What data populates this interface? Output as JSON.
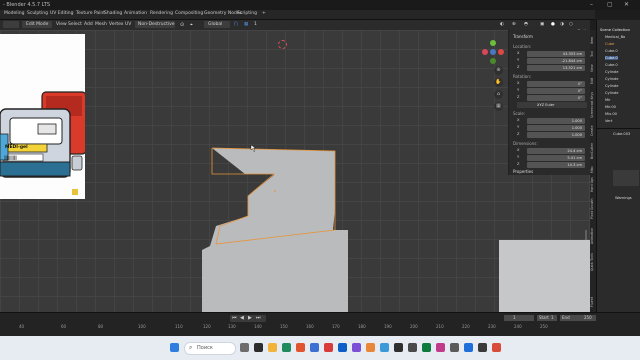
{
  "window": {
    "title": "- Blender 4.5.7 LTS"
  },
  "menus": [
    "Modeling",
    "Sculpting",
    "UV Editing",
    "Texture Paint",
    "Shading",
    "Animation",
    "Rendering",
    "Compositing",
    "Geometry Nodes",
    "Scripting"
  ],
  "toolbar": {
    "edit_mode": "Edit Mode",
    "view": "View",
    "select": "Select",
    "add": "Add",
    "mesh": "Mesh",
    "vertex": "Vertex",
    "edge": "Edge",
    "face": "Face",
    "uv": "UV",
    "non_destructive": "Non-Destructive",
    "transform_orientation": "Global",
    "snap_value": "1",
    "proportional": "1.00 m",
    "options": "Options"
  },
  "reference_image": {
    "label_text": "MEDI-gel",
    "barcode_text": "|||||||||||||||"
  },
  "npanel": {
    "section_transform": "Transform",
    "location_label": "Location:",
    "location": {
      "x": "43.353 cm",
      "y": "-21.844 cm",
      "z": "13.521 cm"
    },
    "rotation_label": "Rotation:",
    "rotation": {
      "x": "0°",
      "y": "0°",
      "z": "0°"
    },
    "rotation_mode": "XYZ Euler",
    "scale_label": "Scale:",
    "scale": {
      "x": "1.000",
      "y": "1.000",
      "z": "1.000"
    },
    "dimensions_label": "Dimensions:",
    "dimensions": {
      "x": "24.4 cm",
      "y": "5.41 cm",
      "z": "14.3 cm"
    },
    "section_properties": "Properties",
    "axis_x": "X",
    "axis_y": "Y",
    "axis_z": "Z"
  },
  "npanel_tabs": [
    "Item",
    "Tool",
    "View",
    "Edit",
    "Screencast Keys",
    "Create",
    "BoxCutter",
    "Misc",
    "Hard Ops",
    "Plant Growth",
    "Animation",
    "Quick Tools",
    "Fluent"
  ],
  "outliner": {
    "header": "Scene Collection",
    "items": [
      "Medical_Bo",
      "Cube",
      "Cube.0",
      "Cube.0",
      "Cube.0",
      "Cylinde",
      "Cylinde",
      "Cylinde",
      "Cylinde",
      "Mir",
      "Mir.00",
      "Mix.00",
      "Vert"
    ],
    "props_object": "Cube.003",
    "modifier_label": "Warnings"
  },
  "timeline": {
    "frame_numbers": [
      "40",
      "60",
      "80",
      "100",
      "110",
      "120",
      "130",
      "140",
      "150",
      "160",
      "170",
      "180",
      "190",
      "200",
      "210",
      "220",
      "230",
      "240",
      "250"
    ],
    "current_frame": "1",
    "start_label": "Start",
    "start": "1",
    "end_label": "End",
    "end": "250"
  },
  "taskbar": {
    "search_placeholder": "Поиск"
  },
  "colors": {
    "viewport_bg": "#3a3a3a",
    "mesh_fill": "#b9bbbd",
    "selection_edge": "#e8943a",
    "accent_blue": "#4a78c0"
  }
}
